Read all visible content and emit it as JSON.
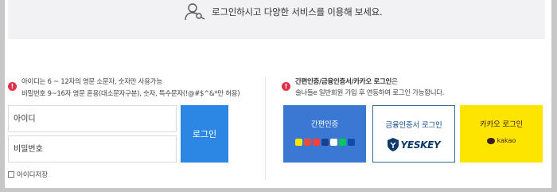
{
  "banner": {
    "icon": "user-key-icon",
    "text": "로그인하시고 다양한 서비스를 이용해 보세요."
  },
  "id_login": {
    "info_badge": "!",
    "info_line1": "아이디는 6 ~ 12자의 영문 소문자, 숫자만 사용가능",
    "info_line2": "비밀번호 9~16자 영문 혼용(대소문자구분), 숫자, 특수문자(!@#$^&*만 허용)",
    "id_placeholder": "아이디",
    "pw_placeholder": "비밀번호",
    "login_button": "로그인",
    "save_id_label": "아이디저장",
    "save_id_checked": false
  },
  "cert_login": {
    "info_badge": "!",
    "info_title": "간편인증/금융인증서/카카오 로그인",
    "info_title_suffix": "은",
    "info_line2": "술나들e 일반회원 가입 후 연동하여 로그인 가능합니다.",
    "simple_label": "간편인증",
    "cert_label": "금융인증서 로그인",
    "cert_brand": "YESKEY",
    "kakao_label": "카카오 로그인",
    "kakao_brand": "kakao"
  },
  "colors": {
    "login_button": "#2b87e3",
    "simple_card": "#3a78d3",
    "cert_border": "#3a6a98",
    "kakao_card": "#fee500",
    "info_badge": "#e0314b",
    "banner_bg": "#f2f2f5"
  }
}
